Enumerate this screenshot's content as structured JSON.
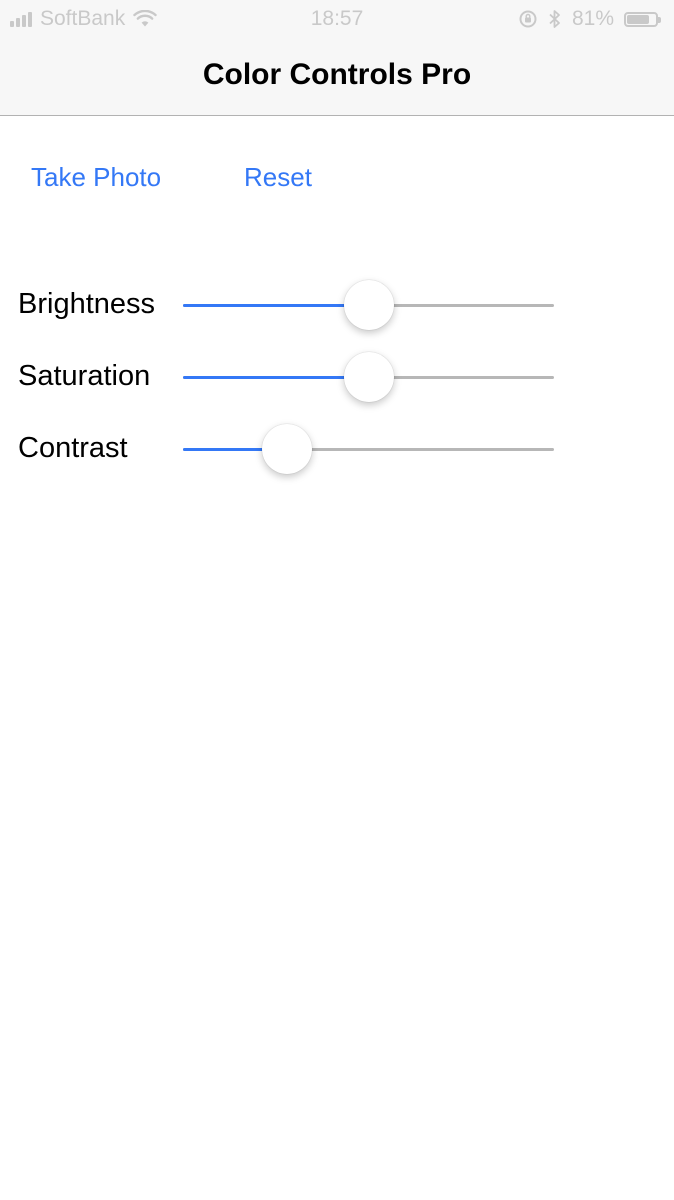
{
  "status_bar": {
    "carrier": "SoftBank",
    "time": "18:57",
    "battery_text": "81%",
    "battery_level": 0.81,
    "icons": [
      "signal-icon",
      "wifi-icon",
      "orientation-lock-icon",
      "bluetooth-icon",
      "battery-icon"
    ]
  },
  "nav": {
    "title": "Color Controls Pro"
  },
  "actions": {
    "take_photo": "Take Photo",
    "reset": "Reset"
  },
  "sliders": [
    {
      "label": "Brightness",
      "value": 0.5
    },
    {
      "label": "Saturation",
      "value": 0.5
    },
    {
      "label": "Contrast",
      "value": 0.28
    }
  ],
  "colors": {
    "accent": "#3478f6",
    "track": "#b7b7b7",
    "bar_background": "#f7f7f7",
    "status_text": "#c9c9c9"
  }
}
